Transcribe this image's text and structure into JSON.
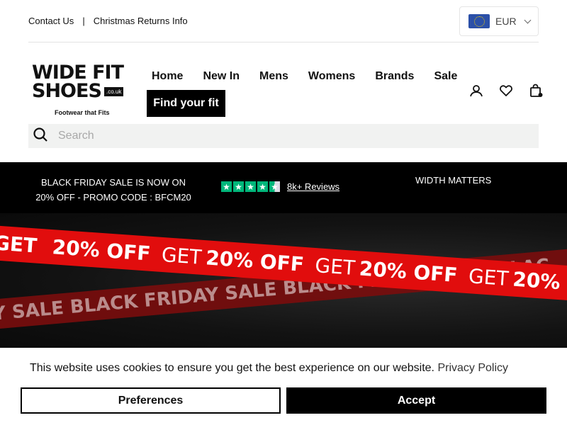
{
  "topbar": {
    "links": [
      "Contact Us",
      "Christmas Returns Info"
    ],
    "separator": "|",
    "currency": "EUR"
  },
  "logo": {
    "line1": "WIDE FIT",
    "line2": "SHOES",
    "domain": ".co.uk",
    "tagline": "Footwear that Fits"
  },
  "nav": {
    "items": [
      "Home",
      "New In",
      "Mens",
      "Womens",
      "Brands",
      "Sale"
    ],
    "cta": "Find your fit"
  },
  "icons": [
    "account-icon",
    "wishlist-heart-icon",
    "cart-bag-icon"
  ],
  "search": {
    "placeholder": "Search"
  },
  "promo": {
    "line1": "BLACK FRIDAY SALE IS NOW ON",
    "line2": "20% OFF - PROMO CODE : BFCM20",
    "reviews": "8k+ Reviews",
    "rating_stars": 4.5,
    "slogan": "WIDTH MATTERS"
  },
  "hero": {
    "band_back": "AY SALE   BLACK FRIDAY SALE   BLACK FRIDAY SALE   BLAC",
    "band_front_word": "GET",
    "band_front_offer": "20% OFF"
  },
  "cookie": {
    "message": "This website uses cookies to ensure you get the best experience on our website.",
    "link": "Privacy Policy",
    "preferences": "Preferences",
    "accept": "Accept"
  },
  "colors": {
    "accent_red": "#e10d0d",
    "trustpilot": "#00b67a"
  }
}
